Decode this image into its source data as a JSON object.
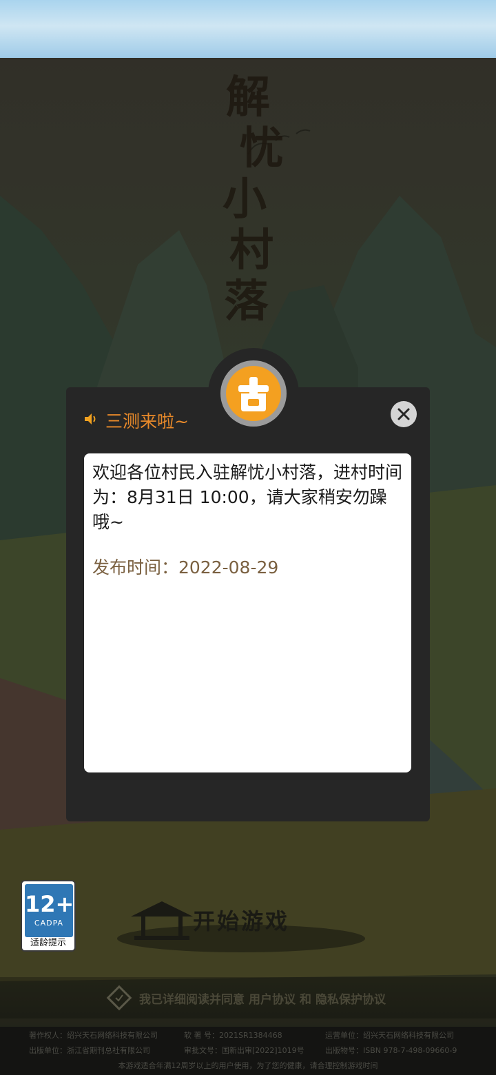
{
  "game": {
    "title_chars": [
      "解",
      "忧",
      "小",
      "村",
      "落"
    ],
    "start_label": "开始游戏"
  },
  "notice": {
    "title": "三测来啦~",
    "body": "欢迎各位村民入驻解忧小村落，进村时间为：8月31日 10:00，请大家稍安勿躁哦~",
    "publish_time": "发布时间：2022-08-29",
    "icon": "speaker-icon",
    "close_icon": "close-icon"
  },
  "age_rating": {
    "age": "12+",
    "org": "CADPA",
    "label": "适龄提示"
  },
  "agreement": {
    "prefix": "我已详细阅读并同意",
    "user_agreement": "用户协议",
    "and": "和",
    "privacy": "隐私保护协议"
  },
  "footer": {
    "copyright_owner": "著作权人：绍兴天石网络科技有限公司",
    "software_reg": "软 著 号：2021SR1384468",
    "operator": "运营单位：绍兴天石网络科技有限公司",
    "publisher": "出版单位：浙江省期刊总社有限公司",
    "approval": "审批文号：国新出审[2022]1019号",
    "isbn": "出版物号：ISBN 978-7-498-09660-9",
    "age_notice": "本游戏适合年满12周岁以上的用户使用，为了您的健康，请合理控制游戏时间"
  },
  "colors": {
    "accent": "#e98a2a",
    "modal_bg": "#262626",
    "date_text": "#7a6040",
    "logo_orange": "#f4a020"
  }
}
